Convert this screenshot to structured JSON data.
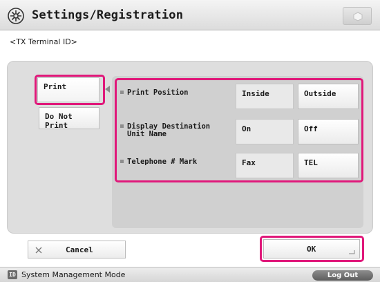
{
  "header": {
    "title": "Settings/Registration",
    "icon": "settings-gear-icon"
  },
  "subtitle": "<TX Terminal ID>",
  "left_options": [
    {
      "label": "Print",
      "selected": true
    },
    {
      "label": "Do Not Print",
      "selected": false
    }
  ],
  "rows": [
    {
      "label": "Print Position",
      "options": [
        "Inside",
        "Outside"
      ],
      "selected": "Inside"
    },
    {
      "label_lines": [
        "Display Destination",
        "Unit Name"
      ],
      "options": [
        "On",
        "Off"
      ],
      "selected": "On"
    },
    {
      "label": "Telephone # Mark",
      "options": [
        "Fax",
        "TEL"
      ],
      "selected": "Fax"
    }
  ],
  "footer": {
    "cancel_label": "Cancel",
    "ok_label": "OK"
  },
  "status_bar": {
    "id_badge": "ID",
    "mode": "System Management Mode",
    "logout_label": "Log Out"
  },
  "colors": {
    "highlight": "#e0187a",
    "header_bg": "#e4e4e4",
    "panel_bg": "#dedede"
  }
}
